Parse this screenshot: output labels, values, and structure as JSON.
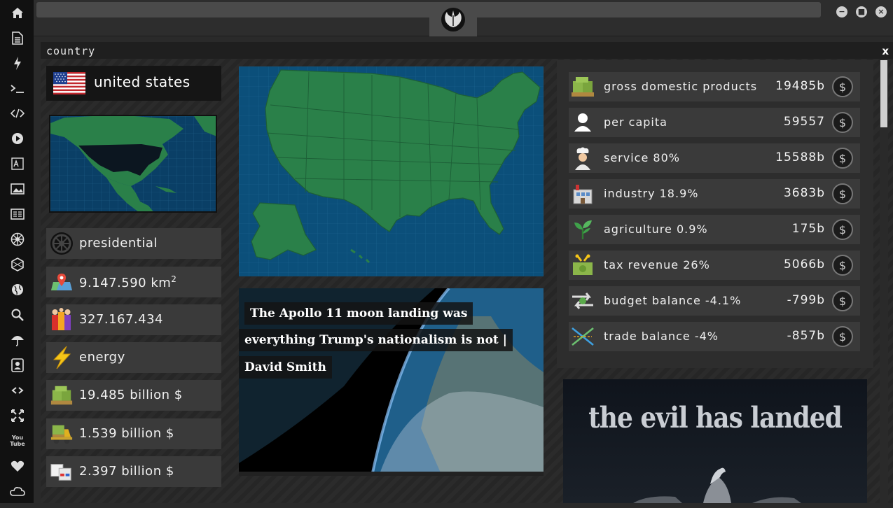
{
  "sidebar": {
    "items": [
      "home-icon",
      "document-icon",
      "lightning-icon",
      "terminal-icon",
      "code-icon",
      "play-icon",
      "translate-icon",
      "image-icon",
      "news-icon",
      "empire-icon",
      "hexagon-icon",
      "globe-icon",
      "search-icon",
      "umbrella-icon",
      "contact-icon",
      "link-icon",
      "expand-icon",
      "youtube-icon",
      "heart-icon",
      "cloud-icon"
    ],
    "youtube_label": "You Tube"
  },
  "window": {
    "title": "country",
    "close": "x"
  },
  "country": {
    "name": "united states",
    "government": "presidential",
    "area_value": "9.147.590 km",
    "area_sup": "2",
    "population": "327.167.434",
    "resource": "energy",
    "gdp_total": "19.485 billion $",
    "import": "1.539 billion $",
    "export": "2.397 billion $"
  },
  "news": {
    "line1": "The Apollo 11 moon landing was",
    "line2": "everything Trump's nationalism is not |",
    "line3": "David Smith"
  },
  "stats": [
    {
      "label": "gross domestic products",
      "value": "19485b",
      "icon": "money-pallet-icon"
    },
    {
      "label": "per capita",
      "value": "59557",
      "icon": "person-icon"
    },
    {
      "label": "service 80%",
      "value": "15588b",
      "icon": "chef-icon"
    },
    {
      "label": "industry 18.9%",
      "value": "3683b",
      "icon": "factory-icon"
    },
    {
      "label": "agriculture 0.9%",
      "value": "175b",
      "icon": "sprout-icon"
    },
    {
      "label": "tax revenue 26%",
      "value": "5066b",
      "icon": "tax-icon"
    },
    {
      "label": "budget balance -4.1%",
      "value": "-799b",
      "icon": "budget-arrows-icon"
    },
    {
      "label": "trade balance -4%",
      "value": "-857b",
      "icon": "trade-icon"
    }
  ],
  "coin_symbol": "$",
  "poster": {
    "title": "the evil has landed"
  },
  "colors": {
    "ocean": "#0b4f7a",
    "land": "#2a8049",
    "panel": "#3a3a3a"
  }
}
